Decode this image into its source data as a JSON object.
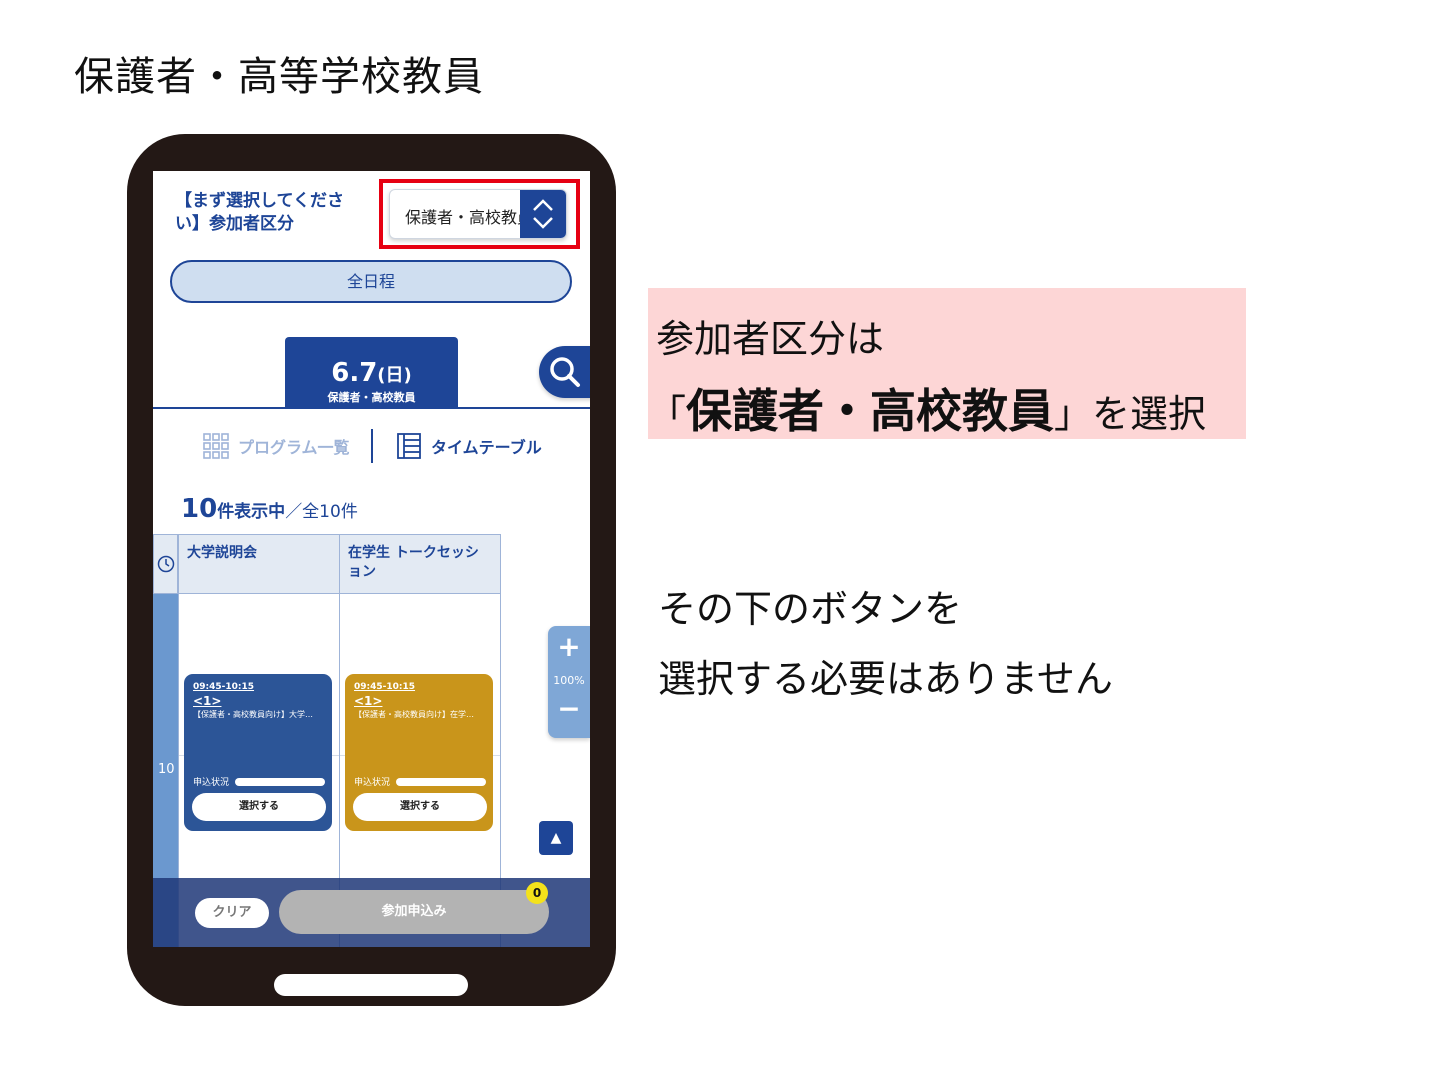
{
  "slide": {
    "title": "保護者・高等学校教員"
  },
  "screen": {
    "category_label": "【まず選択してください】参加者区分",
    "category_select_value": "保護者・高校教員",
    "all_days_label": "全日程",
    "date_tab": {
      "date": "6.7",
      "weekday": "(日)",
      "audience": "保護者・高校教員"
    },
    "views": {
      "program_list": "プログラム一覧",
      "timetable": "タイムテーブル"
    },
    "count": {
      "shown": "10",
      "shown_label": "件表示中",
      "total": "／全10件"
    },
    "columns": [
      {
        "title": "大学説明会"
      },
      {
        "title": "在学生 トークセッション"
      }
    ],
    "time_label": "10",
    "events": [
      {
        "time": "09:45-10:15",
        "number": "<1>",
        "title": "【保護者・高校教員向け】大学…",
        "status_label": "申込状況",
        "select_label": "選択する",
        "color": "#2c5597"
      },
      {
        "time": "09:45-10:15",
        "number": "<1>",
        "title": "【保護者・高校教員向け】在学…",
        "status_label": "申込状況",
        "select_label": "選択する",
        "color": "#c9951b"
      }
    ],
    "zoom": {
      "plus": "+",
      "level": "100%",
      "minus": "−"
    },
    "scroll_top": "▲",
    "bottom": {
      "clear_label": "クリア",
      "apply_label": "参加申込み",
      "badge_count": "0"
    }
  },
  "callout": {
    "line1": "参加者区分は",
    "line2_open": "「",
    "line2_bold": "保護者・高校教員",
    "line2_close": "」を選択"
  },
  "note": {
    "line1": "その下のボタンを",
    "line2": "選択する必要はありません"
  },
  "colors": {
    "brand_blue": "#1e4597",
    "highlight_red": "#e60012",
    "callout_pink": "#fdd6d6",
    "badge_yellow": "#f4e21b"
  }
}
